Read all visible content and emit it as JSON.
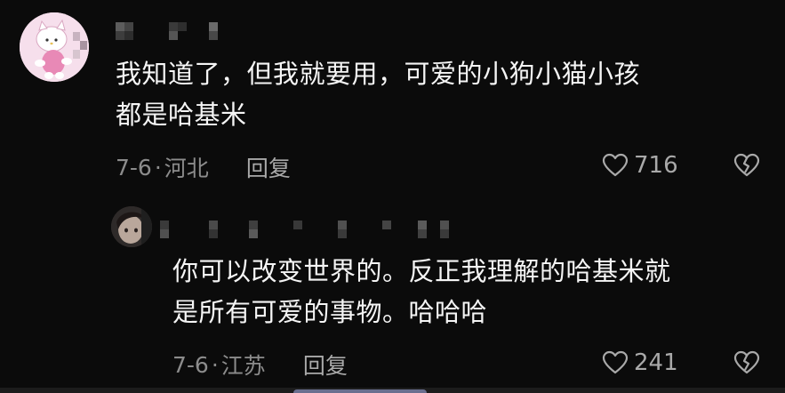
{
  "comments": [
    {
      "text": "我知道了，但我就要用，可爱的小狗小猫小孩\n都是哈基米",
      "date": "7-6",
      "separator": "·",
      "location": "河北",
      "reply_label": "回复",
      "likes": "716",
      "avatar_icon": "hello-kitty-avatar-icon"
    },
    {
      "text": "你可以改变世界的。反正我理解的哈基米就\n是所有可爱的事物。哈哈哈",
      "date": "7-6",
      "separator": "·",
      "location": "江苏",
      "reply_label": "回复",
      "likes": "241",
      "avatar_icon": "user-avatar-icon"
    }
  ],
  "colors": {
    "background": "#0b0b0b",
    "text": "#f5f5f5",
    "meta": "#8c8c8c"
  }
}
